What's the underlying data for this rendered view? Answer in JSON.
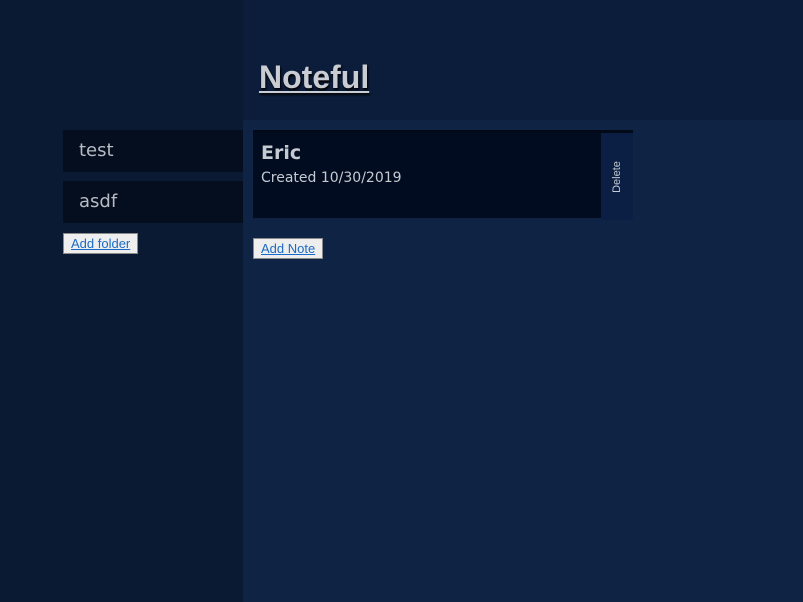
{
  "header": {
    "title": "Noteful"
  },
  "sidebar": {
    "folders": [
      {
        "label": "test"
      },
      {
        "label": "asdf"
      }
    ],
    "add_folder_label": "Add folder"
  },
  "main": {
    "notes": [
      {
        "title": "Eric",
        "created": "Created 10/30/2019",
        "delete_label": "Delete"
      }
    ],
    "add_note_label": "Add Note"
  },
  "colors": {
    "sidebar_bg": "#0b1a33",
    "header_bg": "#0c1d3b",
    "main_bg": "#0f2444",
    "card_bg": "#010c20",
    "folder_bg": "#050e1f",
    "delete_bg": "#0b1f45",
    "link": "#1a6ac7"
  }
}
